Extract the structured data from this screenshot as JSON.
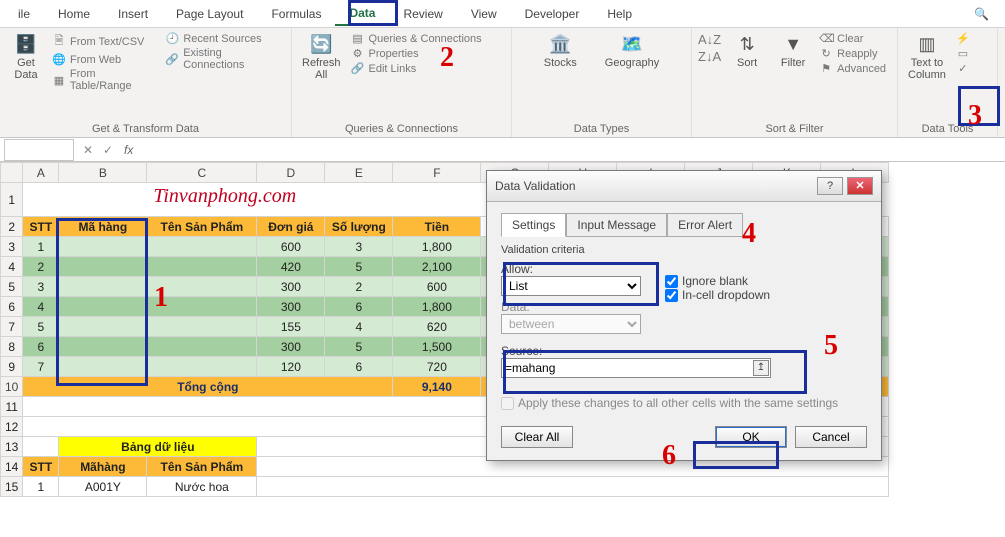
{
  "menu": {
    "tabs": [
      "ile",
      "Home",
      "Insert",
      "Page Layout",
      "Formulas",
      "Data",
      "Review",
      "View",
      "Developer",
      "Help"
    ],
    "active_index": 5
  },
  "ribbon": {
    "get_transform": {
      "label": "Get & Transform Data",
      "big": "Get\nData",
      "items": [
        "From Text/CSV",
        "From Web",
        "From Table/Range",
        "Recent Sources",
        "Existing Connections"
      ]
    },
    "queries": {
      "label": "Queries & Connections",
      "big": "Refresh\nAll",
      "items": [
        "Queries & Connections",
        "Properties",
        "Edit Links"
      ]
    },
    "data_types": {
      "label": "Data Types",
      "buttons": [
        "Stocks",
        "Geography"
      ]
    },
    "sort_filter": {
      "label": "Sort & Filter",
      "sort": "Sort",
      "filter": "Filter",
      "items": [
        "Clear",
        "Reapply",
        "Advanced"
      ]
    },
    "data_tools": {
      "label": "Data Tools",
      "btn": "Text to\nColumn"
    }
  },
  "formula_bar": {
    "name": "",
    "formula": ""
  },
  "watermark": "Tinvanphong.com",
  "columns": [
    "",
    "A",
    "B",
    "C",
    "D",
    "E",
    "F",
    "G",
    "H",
    "I",
    "J",
    "K",
    "L"
  ],
  "headers": [
    "STT",
    "Mã hàng",
    "Tên Sản Phẩm",
    "Đơn giá",
    "Số lượng",
    "Tiền"
  ],
  "rows": [
    {
      "stt": "1",
      "ma": "",
      "ten": "",
      "dg": "600",
      "sl": "3",
      "tien": "1,800"
    },
    {
      "stt": "2",
      "ma": "",
      "ten": "",
      "dg": "420",
      "sl": "5",
      "tien": "2,100"
    },
    {
      "stt": "3",
      "ma": "",
      "ten": "",
      "dg": "300",
      "sl": "2",
      "tien": "600"
    },
    {
      "stt": "4",
      "ma": "",
      "ten": "",
      "dg": "300",
      "sl": "6",
      "tien": "1,800"
    },
    {
      "stt": "5",
      "ma": "",
      "ten": "",
      "dg": "155",
      "sl": "4",
      "tien": "620"
    },
    {
      "stt": "6",
      "ma": "",
      "ten": "",
      "dg": "300",
      "sl": "5",
      "tien": "1,500"
    },
    {
      "stt": "7",
      "ma": "",
      "ten": "",
      "dg": "120",
      "sl": "6",
      "tien": "720"
    }
  ],
  "total": {
    "label": "Tổng cộng",
    "value": "9,140"
  },
  "lookup": {
    "title": "Bảng dữ liệu",
    "h1": "STT",
    "h2": "Mãhàng",
    "h3": "Tên Sản Phẩm",
    "r_stt": "1",
    "r_ma": "A001Y",
    "r_ten": "Nước hoa"
  },
  "dialog": {
    "title": "Data Validation",
    "tabs": [
      "Settings",
      "Input Message",
      "Error Alert"
    ],
    "criteria_label": "Validation criteria",
    "allow_label": "Allow:",
    "allow_value": "List",
    "data_label": "Data:",
    "data_value": "between",
    "ignore_blank": "Ignore blank",
    "incell": "In-cell dropdown",
    "source_label": "Source:",
    "source_value": "=mahang",
    "apply_all": "Apply these changes to all other cells with the same settings",
    "clear": "Clear All",
    "ok": "OK",
    "cancel": "Cancel"
  },
  "annotations": {
    "a1": "1",
    "a2": "2",
    "a3": "3",
    "a4": "4",
    "a5": "5",
    "a6": "6"
  }
}
